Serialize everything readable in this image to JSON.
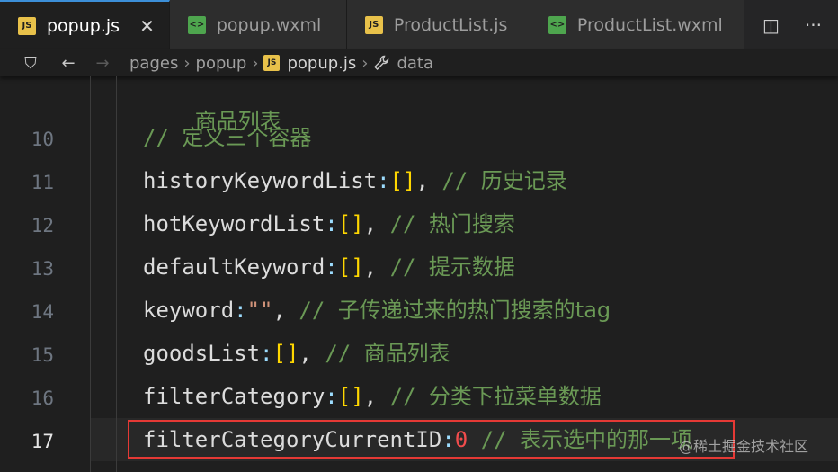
{
  "tabs": [
    {
      "label": "popup.js",
      "type": "js",
      "active": true
    },
    {
      "label": "popup.wxml",
      "type": "wxml",
      "active": false
    },
    {
      "label": "ProductList.js",
      "type": "js",
      "active": false
    },
    {
      "label": "ProductList.wxml",
      "type": "wxml",
      "active": false
    }
  ],
  "tab_icons": {
    "js": "JS",
    "wxml": "<>"
  },
  "close_glyph": "✕",
  "actions": {
    "split": "◫",
    "more": "···"
  },
  "breadcrumb": {
    "nav_back": "←",
    "nav_forward": "→",
    "bookmark": "⛉",
    "items": [
      "pages",
      "popup",
      "popup.js",
      "data"
    ],
    "separator": "›"
  },
  "editor": {
    "current_line": 17,
    "lines": [
      {
        "number": "",
        "property": "",
        "value": "",
        "comment": "商品列表",
        "comment_prefix": ""
      },
      {
        "number": "10",
        "property": "",
        "value": "",
        "comment": "定义三个容器",
        "comment_prefix": "// "
      },
      {
        "number": "11",
        "property": "historyKeywordList",
        "value": "[]",
        "comment": "历史记录",
        "comment_prefix": "// "
      },
      {
        "number": "12",
        "property": "hotKeywordList",
        "value": "[]",
        "comment": "热门搜索",
        "comment_prefix": "// "
      },
      {
        "number": "13",
        "property": "defaultKeyword",
        "value": "[]",
        "comment": "提示数据",
        "comment_prefix": "// "
      },
      {
        "number": "14",
        "property": "keyword",
        "value": "\"\"",
        "comment": "子传递过来的热门搜索的tag",
        "comment_prefix": "// "
      },
      {
        "number": "15",
        "property": "goodsList",
        "value": "[]",
        "comment": "商品列表",
        "comment_prefix": "// "
      },
      {
        "number": "16",
        "property": "filterCategory",
        "value": "[]",
        "comment": "分类下拉菜单数据",
        "comment_prefix": "// "
      },
      {
        "number": "17",
        "property": "filterCategoryCurrentID",
        "value": "0",
        "comment": "表示选中的那一项",
        "comment_prefix": "// "
      }
    ]
  },
  "watermark": "@稀土掘金技术社区",
  "colors": {
    "highlight_border": "#e53935",
    "comment": "#6a9955",
    "bracket": "#ffd700",
    "number": "#f14c4c",
    "string": "#ce9178"
  }
}
